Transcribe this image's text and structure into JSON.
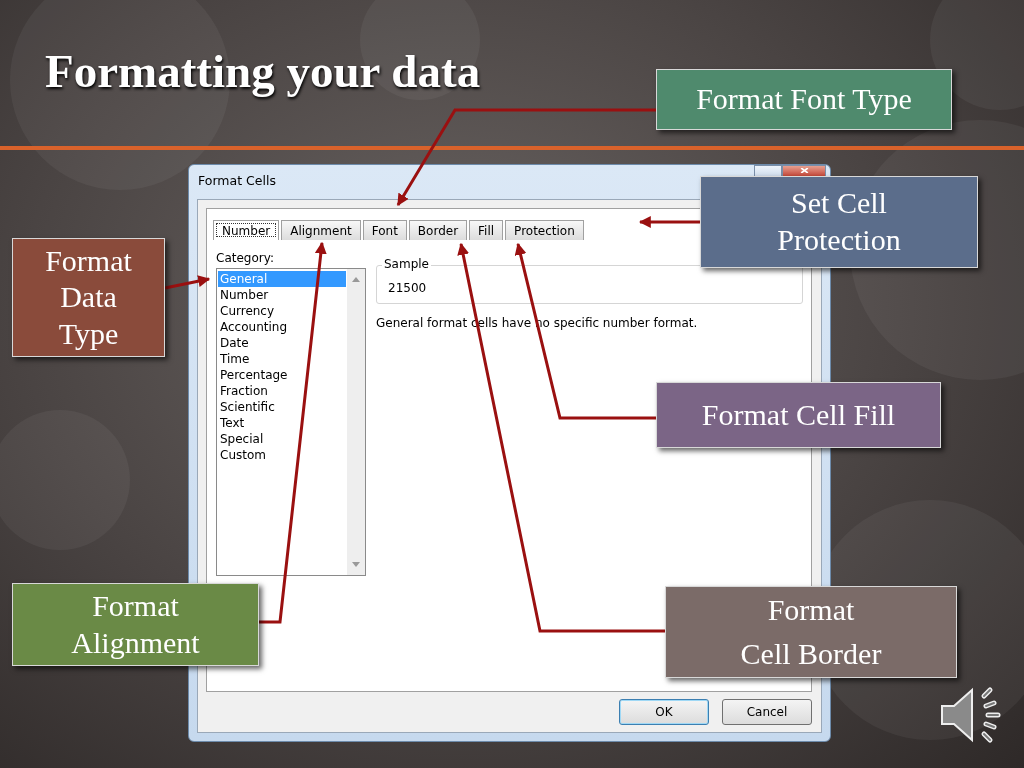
{
  "slide": {
    "title": "Formatting your data"
  },
  "dialog": {
    "title": "Format Cells",
    "tabs": [
      {
        "label": "Number",
        "selected": true
      },
      {
        "label": "Alignment",
        "selected": false
      },
      {
        "label": "Font",
        "selected": false
      },
      {
        "label": "Border",
        "selected": false
      },
      {
        "label": "Fill",
        "selected": false
      },
      {
        "label": "Protection",
        "selected": false
      }
    ],
    "category_label": "Category:",
    "categories": [
      {
        "label": "General",
        "selected": true
      },
      {
        "label": "Number",
        "selected": false
      },
      {
        "label": "Currency",
        "selected": false
      },
      {
        "label": "Accounting",
        "selected": false
      },
      {
        "label": "Date",
        "selected": false
      },
      {
        "label": "Time",
        "selected": false
      },
      {
        "label": "Percentage",
        "selected": false
      },
      {
        "label": "Fraction",
        "selected": false
      },
      {
        "label": "Scientific",
        "selected": false
      },
      {
        "label": "Text",
        "selected": false
      },
      {
        "label": "Special",
        "selected": false
      },
      {
        "label": "Custom",
        "selected": false
      }
    ],
    "sample_label": "Sample",
    "sample_value": "21500",
    "description": "General format cells have no specific number format.",
    "buttons": [
      {
        "label": "OK",
        "default": true
      },
      {
        "label": "Cancel",
        "default": false
      }
    ]
  },
  "callouts": [
    {
      "lines": [
        "Format Font Type"
      ],
      "color": "#4f8a6d"
    },
    {
      "lines": [
        "Set Cell",
        "Protection"
      ],
      "color": "#5b6d8b"
    },
    {
      "lines": [
        "Format",
        "Data",
        "Type"
      ],
      "color": "#8a4b3b"
    },
    {
      "lines": [
        "Format Cell Fill"
      ],
      "color": "#7b6586"
    },
    {
      "lines": [
        "Format",
        "Alignment"
      ],
      "color": "#6a8a46"
    },
    {
      "lines": [
        "Format",
        "Cell Border"
      ],
      "color": "#7b6b68"
    }
  ]
}
